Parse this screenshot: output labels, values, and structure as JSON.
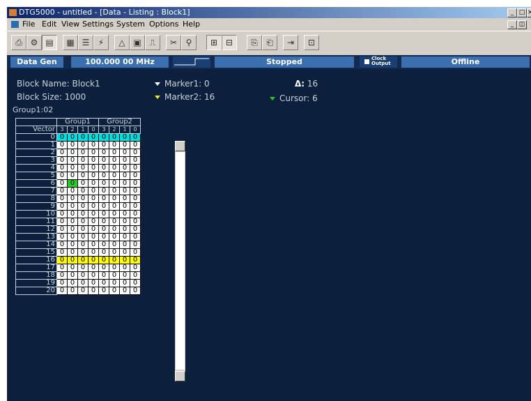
{
  "window": {
    "title": "DTG5000 - untitled - [Data - Listing : Block1]"
  },
  "menu": [
    "File",
    "Edit",
    "View",
    "Settings",
    "System",
    "Options",
    "Help"
  ],
  "status": {
    "mode": "Data Gen",
    "frequency": "100.000 00 MHz",
    "run_state": "Stopped",
    "clock_output": "Clock Output",
    "connection": "Offline"
  },
  "info": {
    "block_name": "Block Name: Block1",
    "block_size": "Block Size: 1000",
    "group_label": "Group1:02",
    "marker1": "Marker1: 0",
    "marker2": "Marker2: 16",
    "delta_label": "Δ:",
    "delta_value": "16",
    "cursor": "Cursor: 6"
  },
  "table": {
    "groups": [
      "Group1",
      "Group2"
    ],
    "vector_label": "Vector",
    "bits": [
      "3",
      "2",
      "1",
      "0",
      "3",
      "2",
      "1",
      "0"
    ],
    "rows": [
      {
        "vector": "0",
        "values": [
          "0",
          "0",
          "0",
          "0",
          "0",
          "0",
          "0",
          "0"
        ],
        "highlight": "cyan"
      },
      {
        "vector": "1",
        "values": [
          "0",
          "0",
          "0",
          "0",
          "0",
          "0",
          "0",
          "0"
        ]
      },
      {
        "vector": "2",
        "values": [
          "0",
          "0",
          "0",
          "0",
          "0",
          "0",
          "0",
          "0"
        ]
      },
      {
        "vector": "3",
        "values": [
          "0",
          "0",
          "0",
          "0",
          "0",
          "0",
          "0",
          "0"
        ]
      },
      {
        "vector": "4",
        "values": [
          "0",
          "0",
          "0",
          "0",
          "0",
          "0",
          "0",
          "0"
        ]
      },
      {
        "vector": "5",
        "values": [
          "0",
          "0",
          "0",
          "0",
          "0",
          "0",
          "0",
          "0"
        ]
      },
      {
        "vector": "6",
        "values": [
          "0",
          "0",
          "0",
          "0",
          "0",
          "0",
          "0",
          "0"
        ],
        "cursor_col": 1
      },
      {
        "vector": "7",
        "values": [
          "0",
          "0",
          "0",
          "0",
          "0",
          "0",
          "0",
          "0"
        ]
      },
      {
        "vector": "8",
        "values": [
          "0",
          "0",
          "0",
          "0",
          "0",
          "0",
          "0",
          "0"
        ]
      },
      {
        "vector": "9",
        "values": [
          "0",
          "0",
          "0",
          "0",
          "0",
          "0",
          "0",
          "0"
        ]
      },
      {
        "vector": "10",
        "values": [
          "0",
          "0",
          "0",
          "0",
          "0",
          "0",
          "0",
          "0"
        ]
      },
      {
        "vector": "11",
        "values": [
          "0",
          "0",
          "0",
          "0",
          "0",
          "0",
          "0",
          "0"
        ]
      },
      {
        "vector": "12",
        "values": [
          "0",
          "0",
          "0",
          "0",
          "0",
          "0",
          "0",
          "0"
        ]
      },
      {
        "vector": "13",
        "values": [
          "0",
          "0",
          "0",
          "0",
          "0",
          "0",
          "0",
          "0"
        ]
      },
      {
        "vector": "14",
        "values": [
          "0",
          "0",
          "0",
          "0",
          "0",
          "0",
          "0",
          "0"
        ]
      },
      {
        "vector": "15",
        "values": [
          "0",
          "0",
          "0",
          "0",
          "0",
          "0",
          "0",
          "0"
        ]
      },
      {
        "vector": "16",
        "values": [
          "0",
          "0",
          "0",
          "0",
          "0",
          "0",
          "0",
          "0"
        ],
        "highlight": "yellow"
      },
      {
        "vector": "17",
        "values": [
          "0",
          "0",
          "0",
          "0",
          "0",
          "0",
          "0",
          "0"
        ]
      },
      {
        "vector": "18",
        "values": [
          "0",
          "0",
          "0",
          "0",
          "0",
          "0",
          "0",
          "0"
        ]
      },
      {
        "vector": "19",
        "values": [
          "0",
          "0",
          "0",
          "0",
          "0",
          "0",
          "0",
          "0"
        ]
      },
      {
        "vector": "20",
        "values": [
          "0",
          "0",
          "0",
          "0",
          "0",
          "0",
          "0",
          "0"
        ]
      }
    ]
  },
  "colors": {
    "background": "#0c1f3c",
    "status_button": "#3a6fb0",
    "marker1": "#00e0e0",
    "marker2": "#ffff00",
    "cursor": "#20d020"
  },
  "icons": [
    "print-icon",
    "settings-icon",
    "data-listing-icon",
    "waveform-icon",
    "grid-icon",
    "marker-icon",
    "timing-icon",
    "copy-block-icon",
    "tile-icon",
    "cut-icon",
    "go-to-icon",
    "properties-icon"
  ]
}
